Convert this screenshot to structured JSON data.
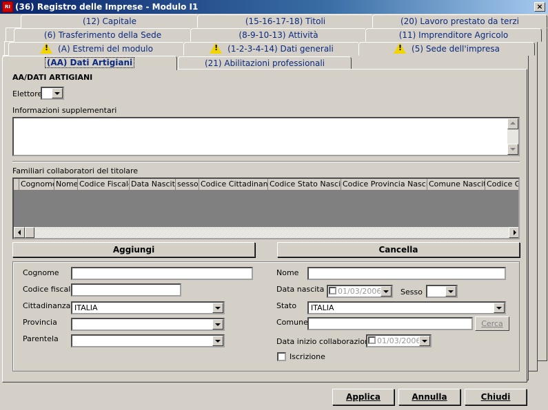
{
  "window": {
    "title": "(36) Registro delle Imprese - Modulo I1",
    "icon": "app-icon",
    "close": "×"
  },
  "tabs": {
    "row1": [
      "(12) Capitale",
      "(15-16-17-18) Titoli",
      "(20) Lavoro prestato da terzi"
    ],
    "row2": [
      "(6) Trasferimento della Sede",
      "(8-9-10-13) Attività",
      "(11) Imprenditore Agricolo"
    ],
    "row3": [
      "(A) Estremi del modulo",
      "(1-2-3-4-14) Dati generali",
      "(5) Sede dell'impresa"
    ],
    "row4": [
      "(AA) Dati Artigiani",
      "(21) Abilitazioni professionali"
    ]
  },
  "section": {
    "title": "AA/DATI ARTIGIANI",
    "elettore_label": "Elettore",
    "info_label": "Informazioni supplementari",
    "familiari_label": "Familiari collaboratori del titolare"
  },
  "grid": {
    "columns": [
      "Cognome",
      "Nome",
      "Codice Fiscale",
      "Data Nascita",
      "sesso",
      "Codice Cittadinanza",
      "Codice Stato Nascita",
      "Codice Provincia Nascita",
      "Comune Nascita",
      "Codice Gr"
    ]
  },
  "buttons": {
    "aggiungi": "Aggiungi",
    "cancella": "Cancella",
    "cerca": "Cerca",
    "applica": "Applica",
    "annulla": "Annulla",
    "chiudi": "Chiudi"
  },
  "form": {
    "cognome_label": "Cognome",
    "codice_fiscale_label": "Codice fiscale",
    "cittadinanza_label": "Cittadinanza",
    "cittadinanza_value": "ITALIA",
    "provincia_label": "Provincia",
    "parentela_label": "Parentela",
    "nome_label": "Nome",
    "data_nascita_label": "Data nascita",
    "data_nascita_value": "01/03/2006",
    "sesso_label": "Sesso",
    "stato_label": "Stato",
    "stato_value": "ITALIA",
    "comune_label": "Comune",
    "data_inizio_label": "Data inizio collaborazione",
    "data_inizio_value": "01/03/2006",
    "iscrizione_label": "Iscrizione"
  }
}
